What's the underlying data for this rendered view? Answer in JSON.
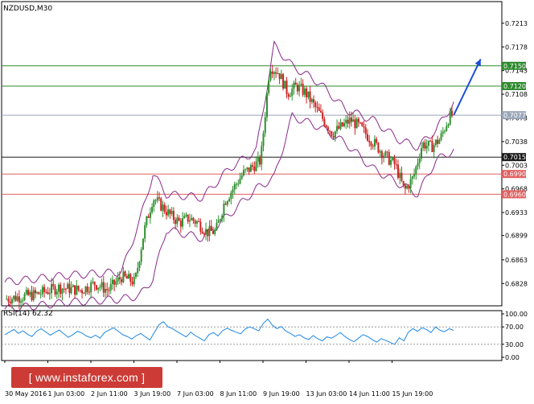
{
  "header": {
    "symbol_timeframe": "NZDUSD,M30"
  },
  "colors": {
    "candle_up": "#2f8f2f",
    "candle_down": "#cc2222",
    "bollinger": "#8a2a8a",
    "resistance_line": "#2f8a2f",
    "support_line": "#e06060",
    "current_line": "#9aa6b8",
    "pivot_line": "#1a1a1a",
    "arrow": "#1a4fd6",
    "rsi_line": "#1e88e5"
  },
  "chart_data": [
    {
      "type": "candlestick",
      "title": "NZDUSD,M30",
      "ylim": [
        0.6795,
        0.7245
      ],
      "y_ticks": [
        "0.7213",
        "0.7178",
        "0.7143",
        "0.7108",
        "0.7073",
        "0.7038",
        "0.7003",
        "0.6968",
        "0.6933",
        "0.6899",
        "0.6863",
        "0.6828"
      ],
      "x_ticks": [
        "30 May 2016",
        "1 Jun 03:00",
        "2 Jun 11:00",
        "3 Jun 19:00",
        "7 Jun 03:00",
        "8 Jun 11:00",
        "9 Jun 19:00",
        "13 Jun 03:00",
        "14 Jun 11:00",
        "15 Jun 19:00"
      ],
      "horizontal_levels": [
        {
          "value": 0.715,
          "label": "0.7150",
          "kind": "resistance"
        },
        {
          "value": 0.712,
          "label": "0.7120",
          "kind": "resistance"
        },
        {
          "value": 0.7077,
          "label": "0.7077",
          "kind": "current"
        },
        {
          "value": 0.7015,
          "label": "0.7015",
          "kind": "pivot"
        },
        {
          "value": 0.699,
          "label": "0.6990",
          "kind": "support"
        },
        {
          "value": 0.696,
          "label": "0.6960",
          "kind": "support"
        }
      ],
      "price_path": [
        [
          0,
          0.6805
        ],
        [
          7,
          0.6812
        ],
        [
          12,
          0.6822
        ],
        [
          17,
          0.6818
        ],
        [
          20,
          0.6828
        ],
        [
          23,
          0.6818
        ],
        [
          26,
          0.6838
        ],
        [
          29,
          0.683
        ],
        [
          31,
          0.6905
        ],
        [
          33,
          0.6955
        ],
        [
          35,
          0.6942
        ],
        [
          37,
          0.6928
        ],
        [
          39,
          0.6918
        ],
        [
          41,
          0.6925
        ],
        [
          43,
          0.6918
        ],
        [
          45,
          0.6904
        ],
        [
          47,
          0.6905
        ],
        [
          49,
          0.695
        ],
        [
          51,
          0.697
        ],
        [
          53,
          0.699
        ],
        [
          55,
          0.7
        ],
        [
          57,
          0.701
        ],
        [
          59,
          0.715
        ],
        [
          61,
          0.714
        ],
        [
          63,
          0.711
        ],
        [
          65,
          0.712
        ],
        [
          67,
          0.711
        ],
        [
          69,
          0.709
        ],
        [
          71,
          0.707
        ],
        [
          73,
          0.705
        ],
        [
          75,
          0.706
        ],
        [
          77,
          0.707
        ],
        [
          79,
          0.706
        ],
        [
          81,
          0.7045
        ],
        [
          83,
          0.703
        ],
        [
          85,
          0.7015
        ],
        [
          87,
          0.7003
        ],
        [
          89,
          0.6965
        ],
        [
          91,
          0.6985
        ],
        [
          93,
          0.7035
        ],
        [
          95,
          0.703
        ],
        [
          97,
          0.7042
        ],
        [
          99,
          0.7075
        ],
        [
          100,
          0.7077
        ]
      ],
      "bollinger_upper": [
        [
          0,
          0.683
        ],
        [
          14,
          0.684
        ],
        [
          26,
          0.6845
        ],
        [
          30,
          0.692
        ],
        [
          33,
          0.699
        ],
        [
          36,
          0.696
        ],
        [
          44,
          0.6955
        ],
        [
          50,
          0.6998
        ],
        [
          56,
          0.7025
        ],
        [
          60,
          0.718
        ],
        [
          64,
          0.715
        ],
        [
          70,
          0.7125
        ],
        [
          76,
          0.7085
        ],
        [
          82,
          0.707
        ],
        [
          88,
          0.704
        ],
        [
          92,
          0.703
        ],
        [
          96,
          0.7055
        ],
        [
          100,
          0.7095
        ]
      ],
      "bollinger_lower": [
        [
          0,
          0.679
        ],
        [
          14,
          0.68
        ],
        [
          26,
          0.6805
        ],
        [
          30,
          0.681
        ],
        [
          33,
          0.6835
        ],
        [
          36,
          0.6908
        ],
        [
          44,
          0.6895
        ],
        [
          50,
          0.693
        ],
        [
          56,
          0.6968
        ],
        [
          60,
          0.6985
        ],
        [
          64,
          0.7075
        ],
        [
          70,
          0.706
        ],
        [
          76,
          0.7035
        ],
        [
          82,
          0.6998
        ],
        [
          88,
          0.6975
        ],
        [
          92,
          0.696
        ],
        [
          96,
          0.701
        ],
        [
          100,
          0.7025
        ]
      ],
      "forecast_arrow": {
        "from": [
          100,
          0.7077
        ],
        "to": [
          106,
          0.716
        ]
      }
    },
    {
      "type": "line",
      "title": "RSI(14) 62.32",
      "ylim": [
        0,
        100
      ],
      "y_ticks": [
        "100.00",
        "70.00",
        "30.00",
        "0.00"
      ],
      "levels": [
        70,
        30
      ],
      "values": [
        52,
        58,
        64,
        55,
        61,
        53,
        48,
        60,
        66,
        59,
        51,
        57,
        63,
        54,
        46,
        52,
        60,
        56,
        49,
        45,
        51,
        44,
        57,
        63,
        68,
        60,
        52,
        48,
        42,
        50,
        55,
        47,
        40,
        58,
        75,
        82,
        70,
        66,
        59,
        53,
        47,
        58,
        50,
        44,
        38,
        52,
        57,
        49,
        61,
        67,
        62,
        58,
        54,
        65,
        70,
        66,
        61,
        78,
        88,
        74,
        66,
        71,
        60,
        55,
        48,
        52,
        45,
        41,
        50,
        43,
        38,
        47,
        44,
        50,
        57,
        48,
        41,
        36,
        44,
        52,
        48,
        41,
        35,
        43,
        39,
        34,
        30,
        45,
        38,
        58,
        66,
        60,
        68,
        64,
        57,
        70,
        62,
        59,
        66,
        62
      ]
    }
  ],
  "watermark": {
    "text": "[ www.instaforex.com ]"
  }
}
